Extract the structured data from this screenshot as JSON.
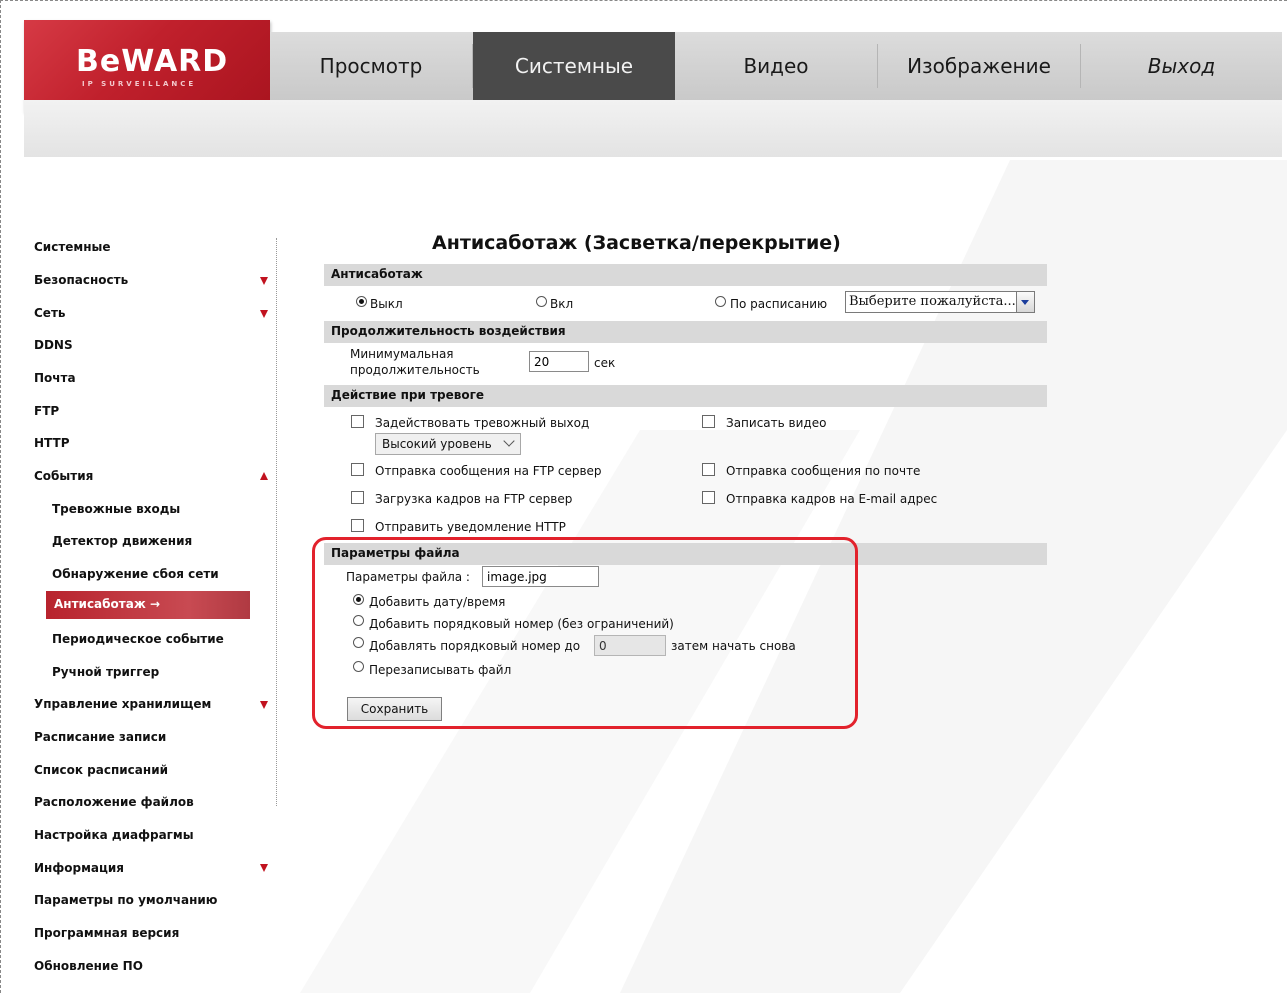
{
  "brand": {
    "logo_text": "BeWARD",
    "logo_subtext": "IP SURVEILLANCE"
  },
  "topnav": [
    {
      "label": "Просмотр",
      "active": false
    },
    {
      "label": "Системные",
      "active": true
    },
    {
      "label": "Видео",
      "active": false
    },
    {
      "label": "Изображение",
      "active": false
    },
    {
      "label": "Выход",
      "active": false
    }
  ],
  "sidebar": {
    "items": [
      {
        "label": "Системные"
      },
      {
        "label": "Безопасность",
        "arrow": "down"
      },
      {
        "label": "Сеть",
        "arrow": "down"
      },
      {
        "label": "DDNS"
      },
      {
        "label": "Почта"
      },
      {
        "label": "FTP"
      },
      {
        "label": "HTTP"
      },
      {
        "label": "События",
        "arrow": "up"
      },
      {
        "label": "Тревожные входы"
      },
      {
        "label": "Детектор движения"
      },
      {
        "label": "Обнаружение сбоя сети"
      },
      {
        "label": "Антисаботаж →",
        "active": true
      },
      {
        "label": "Периодическое событие"
      },
      {
        "label": "Ручной триггер"
      },
      {
        "label": "Управление хранилищем",
        "arrow": "down"
      },
      {
        "label": "Расписание записи"
      },
      {
        "label": "Список расписаний"
      },
      {
        "label": "Расположение файлов"
      },
      {
        "label": "Настройка диафрагмы"
      },
      {
        "label": "Информация",
        "arrow": "down"
      },
      {
        "label": "Параметры по умолчанию"
      },
      {
        "label": "Программная версия"
      },
      {
        "label": "Обновление ПО"
      }
    ]
  },
  "main": {
    "title": "Антисаботаж (Засветка/перекрытие)",
    "sections": {
      "antisabotage": "Антисаботаж",
      "duration": "Продолжительность воздействия",
      "alarm_action": "Действие при тревоге",
      "file_params": "Параметры файла"
    },
    "mode": {
      "off_label": "Выкл",
      "on_label": "Вкл",
      "schedule_label": "По расписанию",
      "selected": "off",
      "schedule_select": "Выберите пожалуйста..."
    },
    "duration": {
      "label_line1": "Минимумальная",
      "label_line2": "продолжительность",
      "value": "20",
      "unit": "сек"
    },
    "actions": {
      "alarm_out": "Задействовать тревожный выход",
      "alarm_level": "Высокий уровень",
      "record_video": "Записать видео",
      "ftp_message": "Отправка сообщения на FTP сервер",
      "mail_message": "Отправка сообщения по почте",
      "ftp_upload": "Загрузка кадров на FTP сервер",
      "email_frames": "Отправка кадров на E-mail адрес",
      "http_notify": "Отправить уведомление HTTP"
    },
    "file": {
      "name_label": "Параметры файла :",
      "name_value": "image.jpg",
      "opt_datetime": "Добавить дату/время",
      "opt_seq_unlimited": "Добавить порядковый номер (без ограничений)",
      "opt_seq_upto": "Добавлять порядковый номер до",
      "seq_upto_value": "0",
      "opt_seq_upto_suffix": "затем начать снова",
      "opt_overwrite": "Перезаписывать файл",
      "selected": "datetime"
    },
    "save_button": "Сохранить"
  },
  "colors": {
    "accent": "#c1121f",
    "highlight": "#e2222c",
    "active_nav": "#4a4a4a"
  }
}
